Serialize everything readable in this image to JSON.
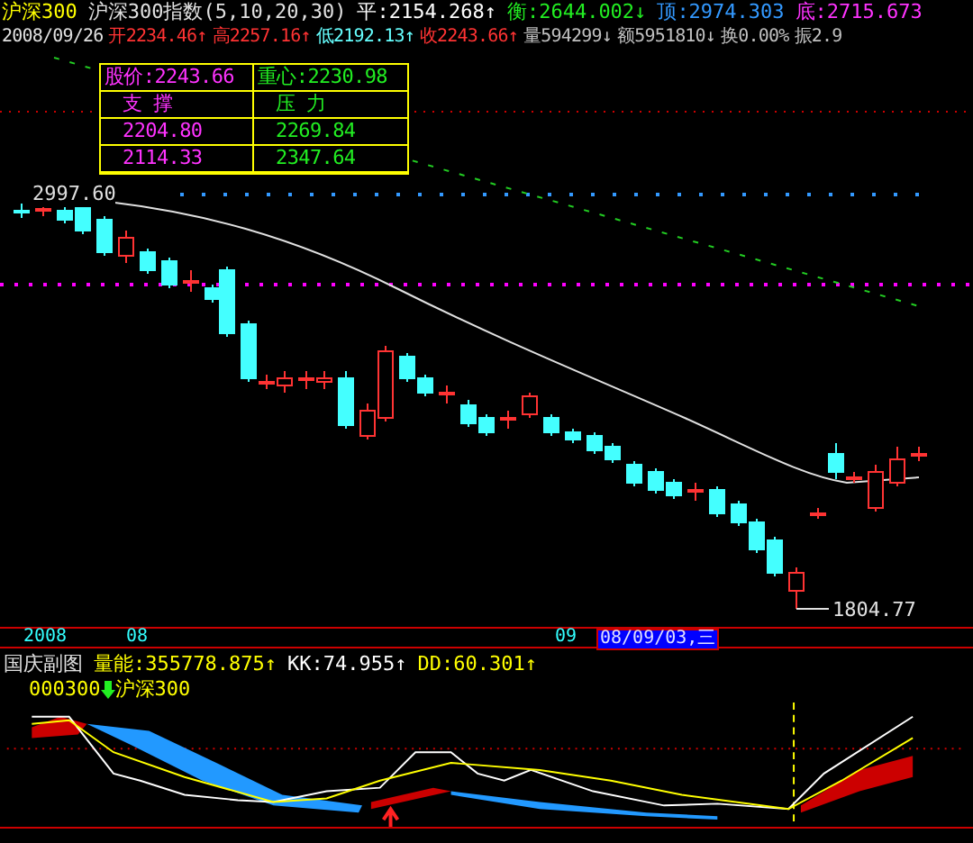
{
  "header": {
    "market": "沪深300",
    "index_name": "沪深300指数(5,10,20,30)",
    "line1": [
      {
        "text": "平:2154.268↑",
        "color": "#ffffff"
      },
      {
        "text": "衡:2644.002↓",
        "color": "#22ee22"
      },
      {
        "text": "顶:2974.303",
        "color": "#3399ff"
      },
      {
        "text": "底:2715.673",
        "color": "#ff33ff"
      }
    ],
    "date": "2008/09/26",
    "line2": [
      {
        "text": "开2234.46↑",
        "color": "#ff3333"
      },
      {
        "text": "高2257.16↑",
        "color": "#ff3333"
      },
      {
        "text": "低2192.13↑",
        "color": "#66ffff"
      },
      {
        "text": "收2243.66↑",
        "color": "#ff3333"
      },
      {
        "text": "量594299↓",
        "color": "#c0c0c0"
      },
      {
        "text": "额5951810↓",
        "color": "#c0c0c0"
      },
      {
        "text": "换0.00%",
        "color": "#c0c0c0"
      },
      {
        "text": "振2.9",
        "color": "#c0c0c0"
      }
    ]
  },
  "info_box": {
    "rows": [
      [
        {
          "text": "股价:2243.66",
          "color": "#ff33ff"
        },
        {
          "text": "重心:2230.98",
          "color": "#22ee22"
        }
      ],
      [
        {
          "text": "支 撑",
          "color": "#ff33ff"
        },
        {
          "text": "压 力",
          "color": "#22ee22"
        }
      ],
      [
        {
          "text": "2204.80",
          "color": "#ff33ff"
        },
        {
          "text": "2269.84",
          "color": "#22ee22"
        }
      ],
      [
        {
          "text": "2114.33",
          "color": "#ff33ff"
        },
        {
          "text": "2347.64",
          "color": "#22ee22"
        }
      ]
    ]
  },
  "price_labels": {
    "high": "2997.60",
    "low": "1804.77"
  },
  "time_axis": [
    {
      "text": "2008",
      "selected": false
    },
    {
      "text": "08",
      "selected": false
    },
    {
      "text": "09",
      "selected": false
    },
    {
      "text": "08/09/03,三",
      "selected": true
    }
  ],
  "sub_chart": {
    "title": "国庆副图",
    "indicators": [
      {
        "text": "量能:355778.875↑",
        "color": "#ffff00"
      },
      {
        "text": "KK:74.955↑",
        "color": "#ffffff"
      },
      {
        "text": "DD:60.301↑",
        "color": "#ffff00"
      }
    ],
    "code": "000300",
    "name": "沪深300"
  }
}
